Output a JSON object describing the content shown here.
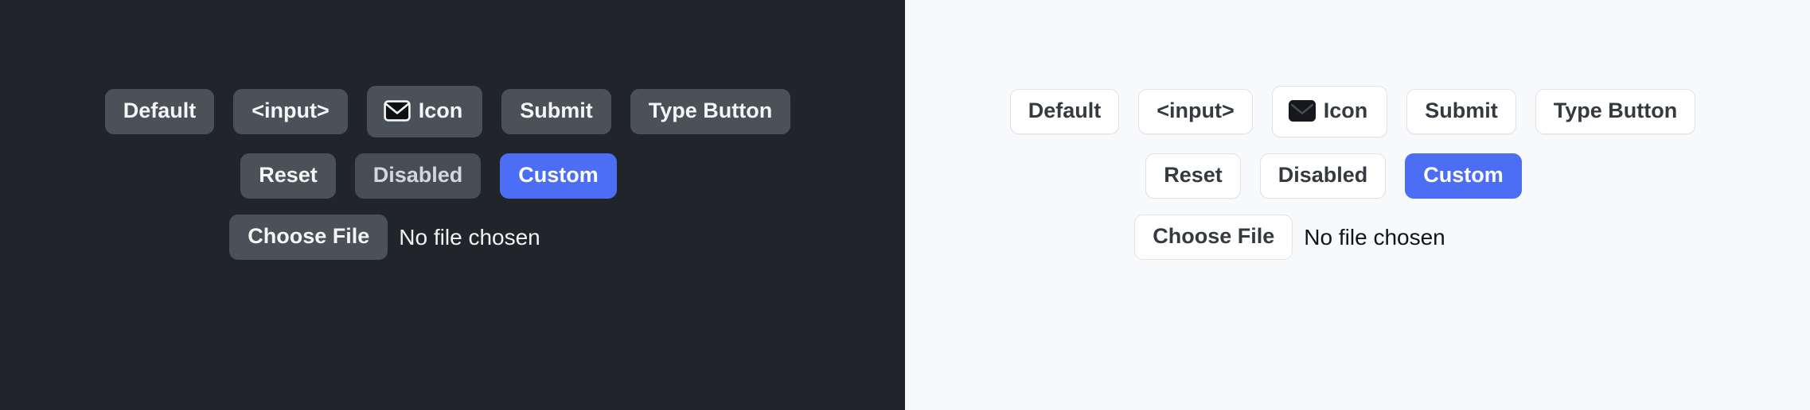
{
  "panels": [
    {
      "theme": "dark",
      "background_color": "#212529",
      "button_bg": "#4b5159",
      "text_color": "#f4f5f7",
      "accent_color": "#4c6ef5"
    },
    {
      "theme": "light",
      "background_color": "#f8f9fb",
      "button_bg": "#ffffff",
      "text_color": "#343a40",
      "accent_color": "#4c6ef5"
    }
  ],
  "buttons": {
    "row1": [
      {
        "label": "Default",
        "name": "default-button"
      },
      {
        "label": "<input>",
        "name": "input-button"
      },
      {
        "label": "Icon",
        "name": "icon-button",
        "icon": "envelope-icon"
      },
      {
        "label": "Submit",
        "name": "submit-button"
      },
      {
        "label": "Type Button",
        "name": "type-button"
      }
    ],
    "row2": [
      {
        "label": "Reset",
        "name": "reset-button"
      },
      {
        "label": "Disabled",
        "name": "disabled-button"
      },
      {
        "label": "Custom",
        "name": "custom-button"
      }
    ]
  },
  "file_input": {
    "button_label": "Choose File",
    "status_text": "No file chosen"
  }
}
